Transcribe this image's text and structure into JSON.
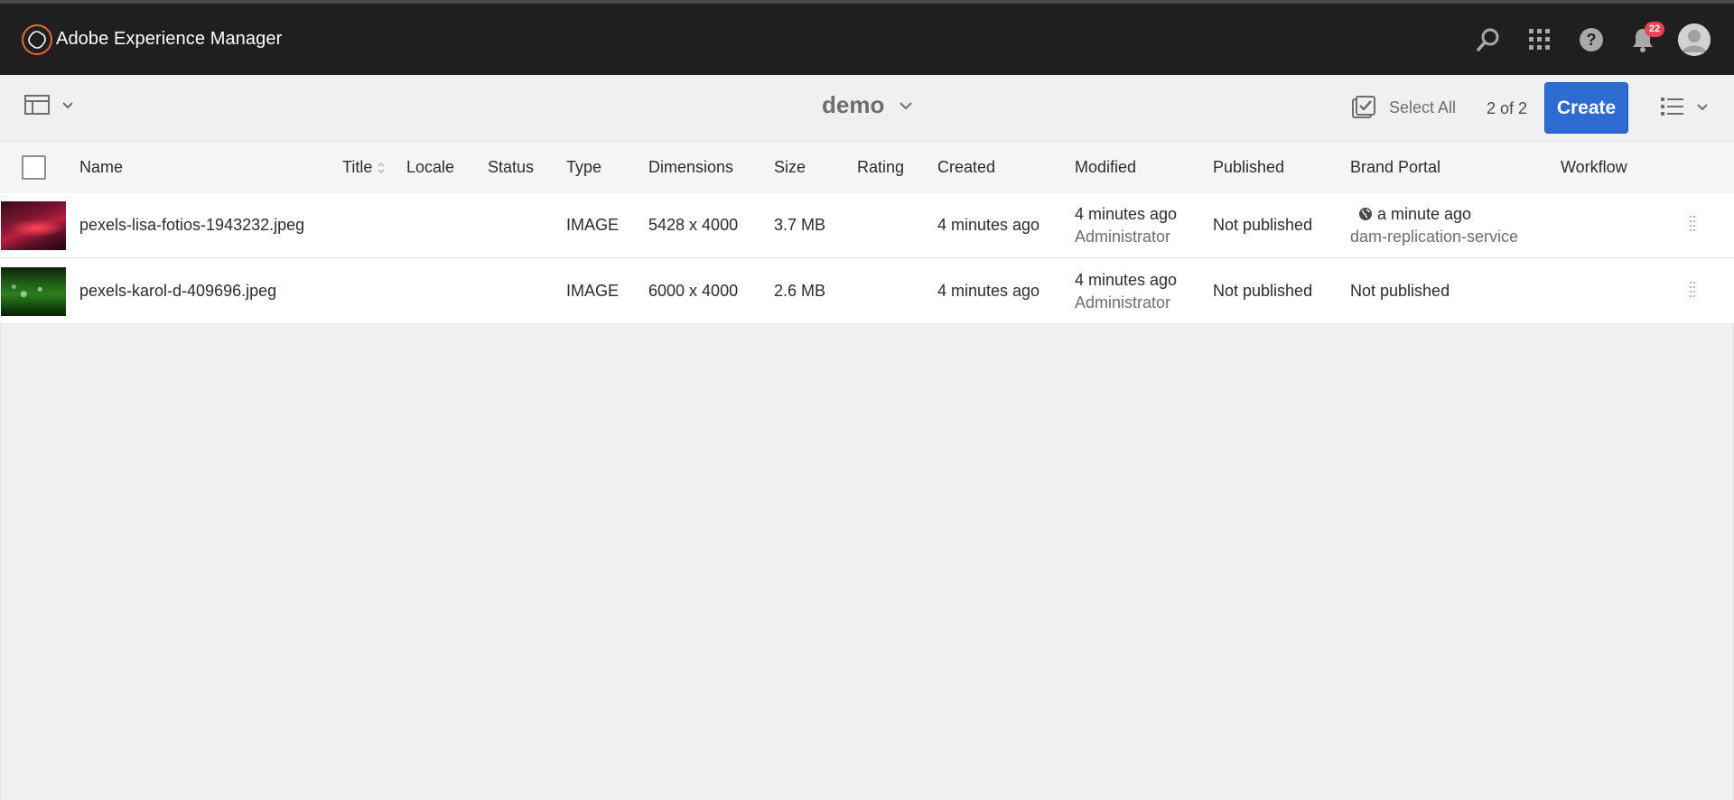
{
  "header": {
    "app_title": "Adobe Experience Manager",
    "notification_count": "22",
    "icons": [
      "adobe-logo-icon",
      "search-icon",
      "apps-grid-icon",
      "help-icon",
      "bell-icon",
      "user-avatar-icon"
    ]
  },
  "toolbar": {
    "folder_title": "demo",
    "select_all_label": "Select All",
    "count_label": "2 of 2",
    "create_label": "Create",
    "create_color": "#2d6bd0"
  },
  "table": {
    "columns": {
      "name": "Name",
      "title": "Title",
      "locale": "Locale",
      "status": "Status",
      "type": "Type",
      "dimensions": "Dimensions",
      "size": "Size",
      "rating": "Rating",
      "created": "Created",
      "modified": "Modified",
      "published": "Published",
      "brand_portal": "Brand Portal",
      "workflow": "Workflow"
    },
    "rows": [
      {
        "name": "pexels-lisa-fotios-1943232.jpeg",
        "type": "IMAGE",
        "dimensions": "5428 x 4000",
        "size": "3.7 MB",
        "created": "4 minutes ago",
        "modified": "4 minutes ago",
        "modified_by": "Administrator",
        "published": "Not published",
        "brand_portal": "a minute ago",
        "brand_portal_by": "dam-replication-service"
      },
      {
        "name": "pexels-karol-d-409696.jpeg",
        "type": "IMAGE",
        "dimensions": "6000 x 4000",
        "size": "2.6 MB",
        "created": "4 minutes ago",
        "modified": "4 minutes ago",
        "modified_by": "Administrator",
        "published": "Not published",
        "brand_portal": "Not published"
      }
    ]
  }
}
